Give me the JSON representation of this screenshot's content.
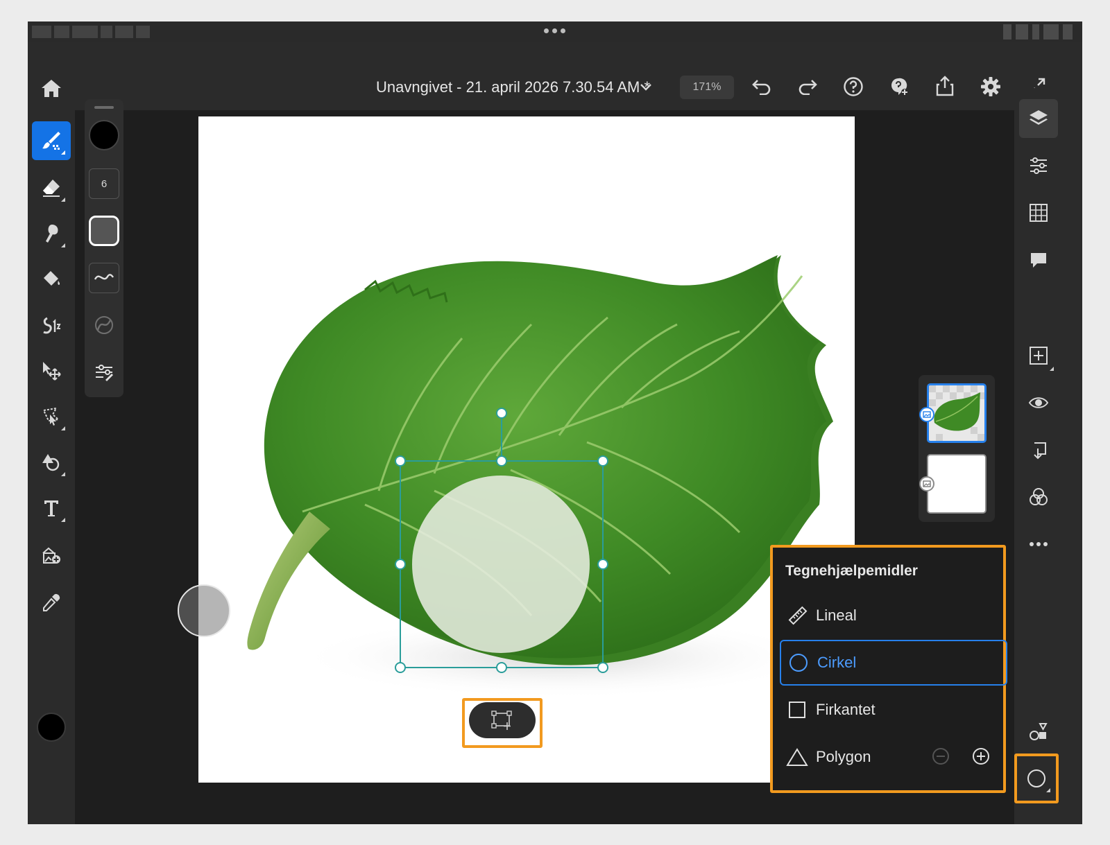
{
  "status_bar": {
    "grabber": "more-dots"
  },
  "header": {
    "document_title": "Unavngivet - 21. april 2026 7.30.54 AM *",
    "zoom": "171%"
  },
  "tool_options": {
    "brush_size": "6"
  },
  "layers": [
    {
      "name": "leaf-image-layer",
      "selected": true
    },
    {
      "name": "background-layer",
      "selected": false
    }
  ],
  "drawing_aids": {
    "title": "Tegnehjælpemidler",
    "items": [
      {
        "label": "Lineal",
        "icon": "ruler-icon",
        "selected": false
      },
      {
        "label": "Cirkel",
        "icon": "circle-icon",
        "selected": true
      },
      {
        "label": "Firkantet",
        "icon": "square-icon",
        "selected": false
      },
      {
        "label": "Polygon",
        "icon": "triangle-icon",
        "selected": false
      }
    ]
  },
  "colors": {
    "accent": "#1473e6",
    "highlight": "#f29a1f",
    "selection": "#2a9d9a",
    "foreground": "#000000"
  }
}
